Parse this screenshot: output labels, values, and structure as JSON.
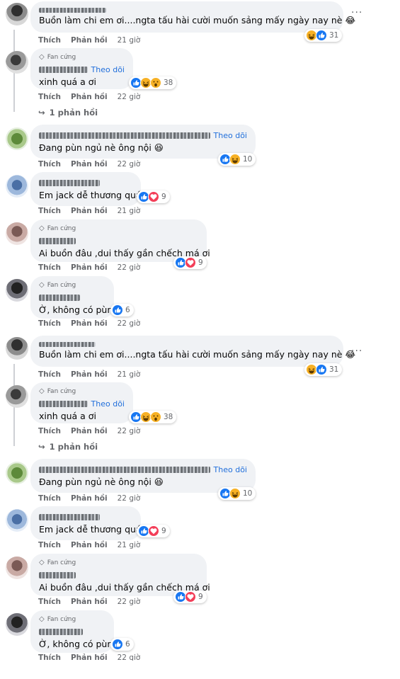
{
  "actions": {
    "like": "Thích",
    "reply": "Phản hồi"
  },
  "badge_label": "Fan cứng",
  "follow_label": "Theo dõi",
  "more_label": "···",
  "comments": [
    {
      "text": "Buồn làm chi em ơi....ngta tấu hài cười muốn sảng mấy ngày nay nè 😂",
      "time": "21 giờ",
      "count": "31",
      "reactions": [
        "haha",
        "like"
      ],
      "badge": false,
      "follow": false
    },
    {
      "text": "xinh quá a ơi",
      "time": "22 giờ",
      "count": "38",
      "reactions": [
        "like",
        "haha",
        "wow"
      ],
      "badge": true,
      "follow": true
    },
    {
      "replies": "1 phản hồi"
    },
    {
      "text": "Đang pùn ngủ nè ông nội 😆",
      "time": "22 giờ",
      "count": "10",
      "reactions": [
        "like",
        "haha"
      ],
      "badge": false,
      "follow": true
    },
    {
      "text": "Em jack dễ thương quá",
      "time": "21 giờ",
      "count": "9",
      "reactions": [
        "like",
        "love"
      ],
      "badge": false,
      "follow": false
    },
    {
      "text": "Ai buồn đâu ,dui thấy gần chếch má ơi",
      "time": "22 giờ",
      "count": "9",
      "reactions": [
        "like",
        "love"
      ],
      "badge": true,
      "follow": false
    },
    {
      "text": "Ờ, không có pùn",
      "time": "22 giờ",
      "count": "6",
      "reactions": [
        "like"
      ],
      "badge": true,
      "follow": false
    }
  ],
  "colors": {
    "like": "#1877f2",
    "love": "#f33e58",
    "haha": "#f7b125",
    "link": "#216fdb",
    "muted": "#65676b",
    "bubble": "#f0f2f5"
  }
}
